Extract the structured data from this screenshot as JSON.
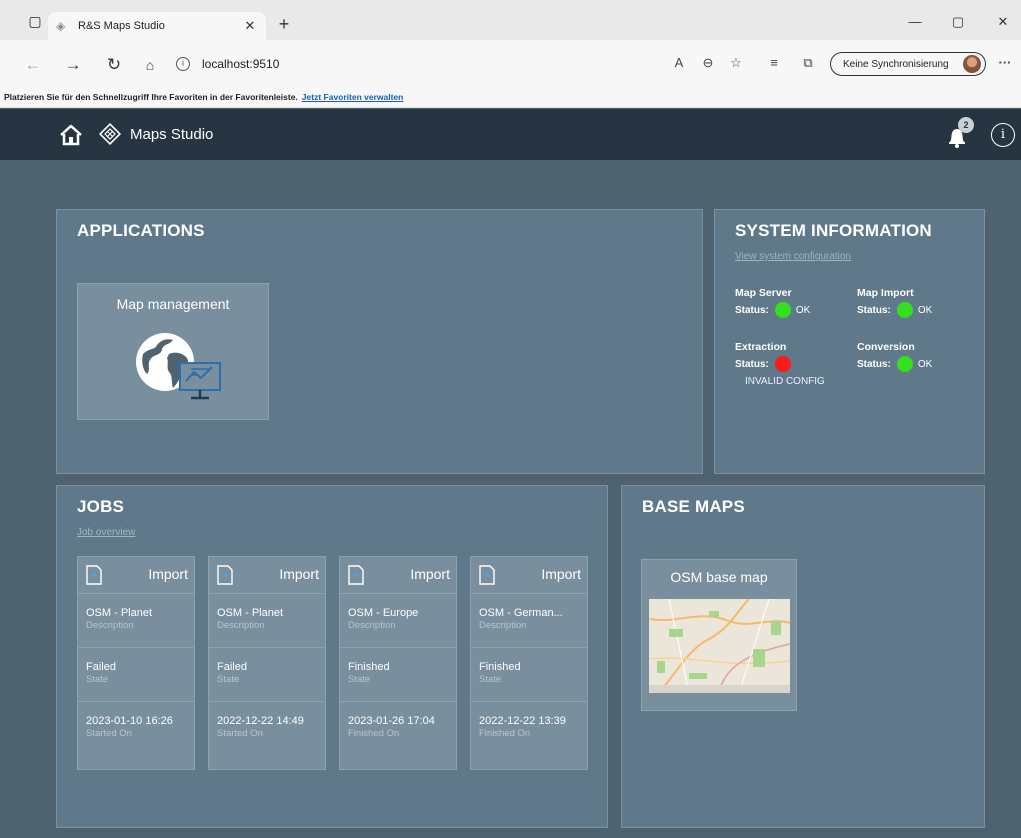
{
  "browser": {
    "tab_title": "R&S Maps Studio",
    "url": "localhost:9510",
    "sync_label": "Keine Synchronisierung",
    "favorites_hint": "Platzieren Sie für den Schnellzugriff Ihre Favoriten in der Favoritenleiste.",
    "favorites_link": "Jetzt Favoriten verwalten"
  },
  "header": {
    "title": "Maps Studio",
    "notification_count": "2",
    "info_label": "i"
  },
  "applications": {
    "title": "APPLICATIONS",
    "tiles": [
      {
        "label": "Map management",
        "icon": "globe-monitor-icon"
      }
    ]
  },
  "system_information": {
    "title": "SYSTEM INFORMATION",
    "link": "View system configuration",
    "status_label": "Status:",
    "services": [
      {
        "name": "Map Server",
        "value": "OK",
        "color": "#32e01c"
      },
      {
        "name": "Map Import",
        "value": "OK",
        "color": "#32e01c"
      },
      {
        "name": "Extraction",
        "value": "",
        "color": "#ff1a1a",
        "error": "INVALID CONFIG"
      },
      {
        "name": "Conversion",
        "value": "OK",
        "color": "#32e01c"
      }
    ]
  },
  "jobs": {
    "title": "JOBS",
    "link": "Job overview",
    "cards": [
      {
        "type": "Import",
        "description": "OSM - Planet",
        "description_label": "Description",
        "state": "Failed",
        "state_label": "State",
        "date": "2023-01-10 16:26",
        "date_label": "Started On"
      },
      {
        "type": "Import",
        "description": "OSM - Planet",
        "description_label": "Description",
        "state": "Failed",
        "state_label": "State",
        "date": "2022-12-22 14:49",
        "date_label": "Started On"
      },
      {
        "type": "Import",
        "description": "OSM - Europe",
        "description_label": "Description",
        "state": "Finished",
        "state_label": "State",
        "date": "2023-01-26 17:04",
        "date_label": "Finished On"
      },
      {
        "type": "Import",
        "description": "OSM - German...",
        "description_label": "Description",
        "state": "Finished",
        "state_label": "State",
        "date": "2022-12-22 13:39",
        "date_label": "Finished On"
      }
    ]
  },
  "base_maps": {
    "title": "BASE MAPS",
    "tiles": [
      {
        "label": "OSM base map"
      }
    ]
  },
  "colors": {
    "header_bg": "#263541",
    "panel_bg": "#60798a",
    "tile_bg": "#7a8f9d",
    "ok": "#32e01c",
    "error": "#ff1a1a"
  }
}
